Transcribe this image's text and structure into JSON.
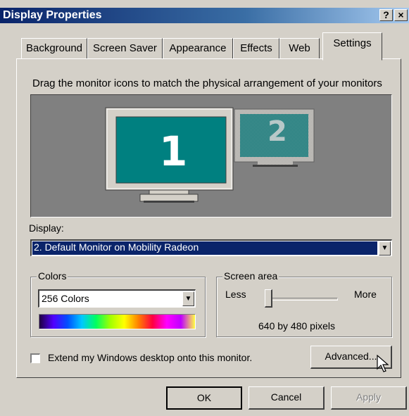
{
  "window": {
    "title": "Display Properties",
    "help_label": "?",
    "close_label": "×"
  },
  "tabs": [
    {
      "label": "Background"
    },
    {
      "label": "Screen Saver"
    },
    {
      "label": "Appearance"
    },
    {
      "label": "Effects"
    },
    {
      "label": "Web"
    },
    {
      "label": "Settings",
      "active": true
    }
  ],
  "settings": {
    "instruction": "Drag the monitor icons to match the physical arrangement of your monitors",
    "monitor1_label": "1",
    "monitor2_label": "2",
    "display_label": "Display:",
    "display_value": "2. Default Monitor on Mobility Radeon",
    "colors": {
      "title": "Colors",
      "value": "256 Colors"
    },
    "screen_area": {
      "title": "Screen area",
      "less_label": "Less",
      "more_label": "More",
      "resolution": "640 by 480 pixels",
      "slider_level": 0
    },
    "extend_desktop_label": "Extend my Windows desktop onto this monitor.",
    "extend_desktop_checked": false,
    "advanced_label": "Advanced..."
  },
  "buttons": {
    "ok": "OK",
    "cancel": "Cancel",
    "apply": "Apply"
  },
  "colors": {
    "desktop_teal": "#008080",
    "title_blue": "#0a246a",
    "selection_navy": "#0a246a",
    "face_gray": "#d4d0c8"
  }
}
